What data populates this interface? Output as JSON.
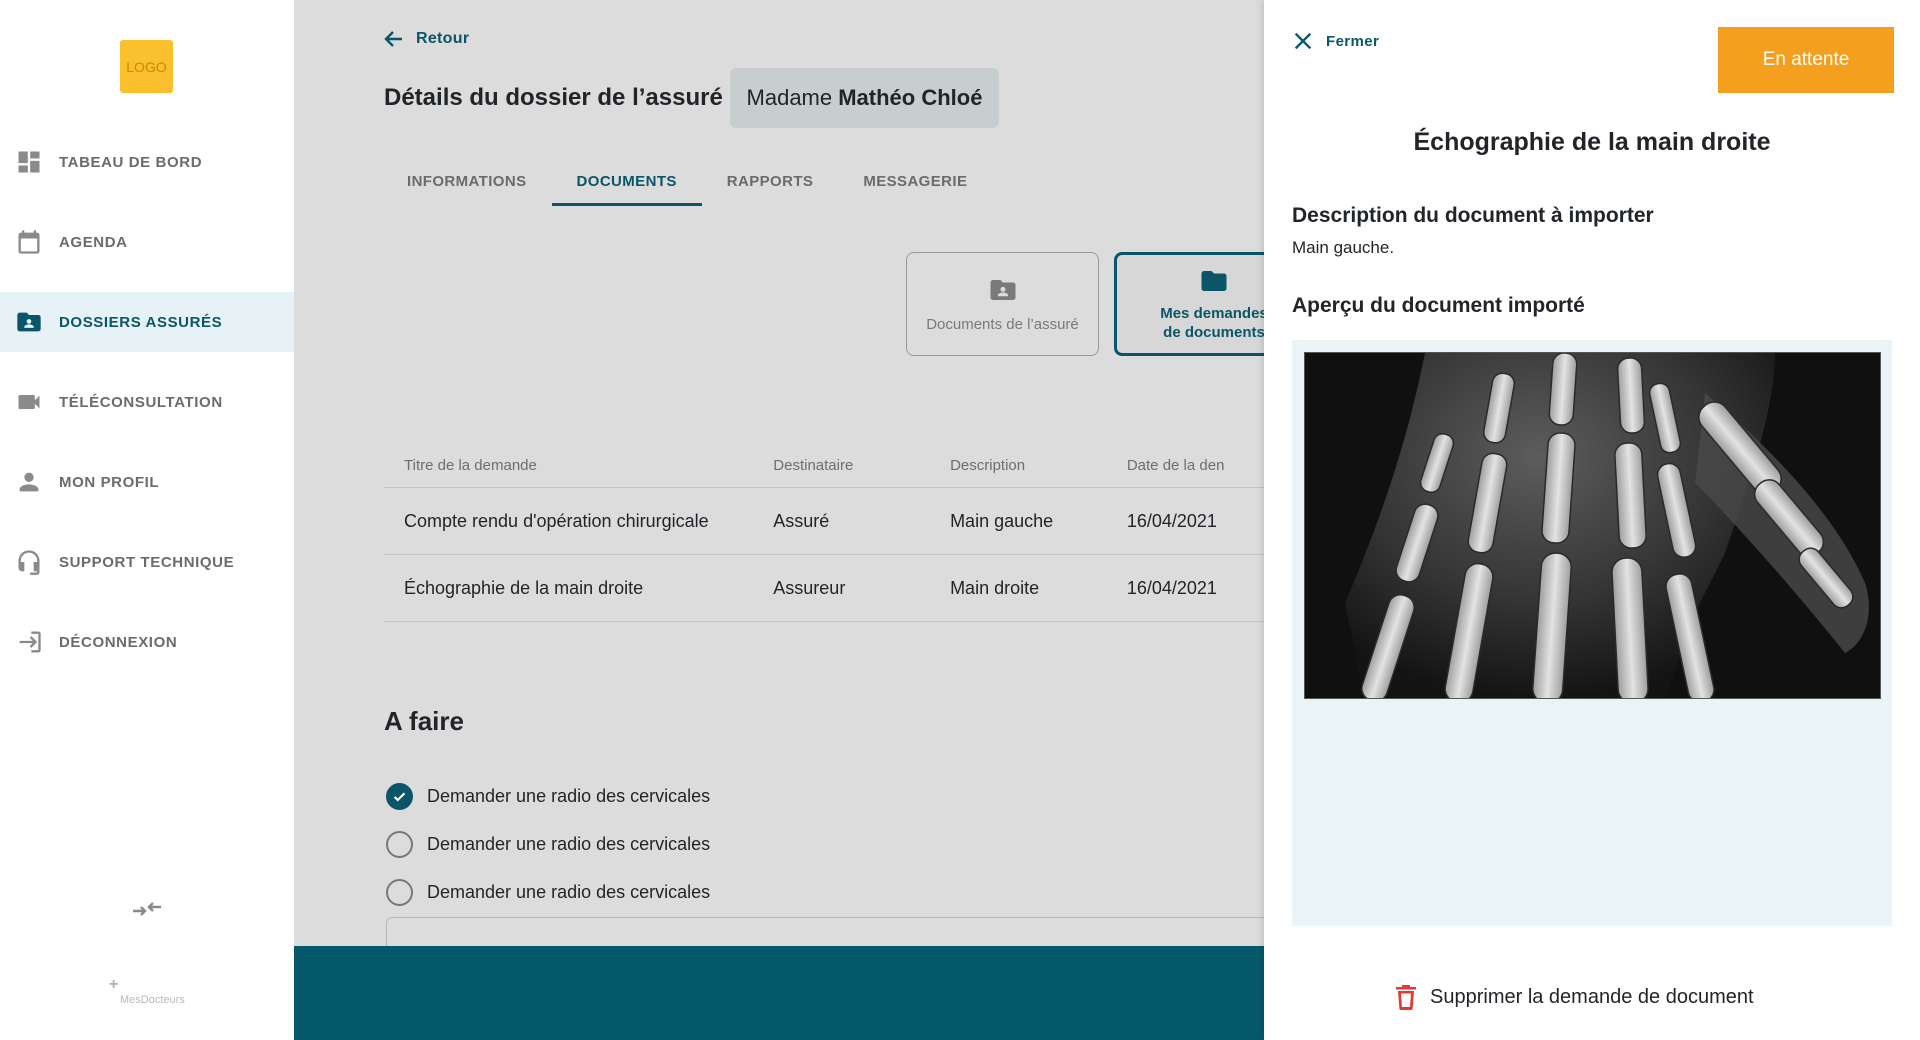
{
  "sidebar": {
    "logo": "LOGO",
    "items": [
      {
        "label": "TABEAU DE BORD",
        "icon": "dashboard-icon"
      },
      {
        "label": "AGENDA",
        "icon": "calendar-icon"
      },
      {
        "label": "DOSSIERS ASSURÉS",
        "icon": "folder-user-icon",
        "active": true
      },
      {
        "label": "TÉLÉCONSULTATION",
        "icon": "video-camera-icon"
      },
      {
        "label": "MON PROFIL",
        "icon": "person-icon"
      },
      {
        "label": "SUPPORT TECHNIQUE",
        "icon": "headset-icon"
      },
      {
        "label": "DÉCONNEXION",
        "icon": "logout-icon"
      }
    ],
    "brand": "MesDocteurs"
  },
  "main": {
    "back_label": "Retour",
    "page_title": "Détails du dossier de l’assuré",
    "patient_prefix": "Madame ",
    "patient_name": "Mathéo Chloé",
    "tabs": [
      {
        "label": "INFORMATIONS"
      },
      {
        "label": "DOCUMENTS",
        "active": true
      },
      {
        "label": "RAPPORTS"
      },
      {
        "label": "MESSAGERIE"
      }
    ],
    "cards": {
      "insured_docs": "Documents de l’assuré",
      "my_requests_line1": "Mes demandes",
      "my_requests_line2": "de documents"
    },
    "table": {
      "headers": [
        "Titre de la demande",
        "Destinataire",
        "Description",
        "Date de la den"
      ],
      "rows": [
        [
          "Compte rendu d'opération chirurgicale",
          "Assuré",
          "Main gauche",
          "16/04/2021"
        ],
        [
          "Échographie de la main droite",
          "Assureur",
          "Main droite",
          "16/04/2021"
        ]
      ]
    },
    "todo": {
      "title": "A faire",
      "items": [
        {
          "label": "Demander une radio des cervicales",
          "checked": true
        },
        {
          "label": "Demander une radio des cervicales",
          "checked": false
        },
        {
          "label": "Demander une radio des cervicales",
          "checked": false
        }
      ]
    }
  },
  "panel": {
    "close_label": "Fermer",
    "status_label": "En attente",
    "status_color": "#f59f1e",
    "title": "Échographie de la main droite",
    "description_title": "Description du document à importer",
    "description_text": "Main gauche.",
    "preview_title": "Aperçu du document importé",
    "delete_label": "Supprimer la demande de document"
  },
  "colors": {
    "primary": "#0a5668",
    "footer": "#05586a",
    "accent": "#f59f1e",
    "danger": "#e53935"
  }
}
